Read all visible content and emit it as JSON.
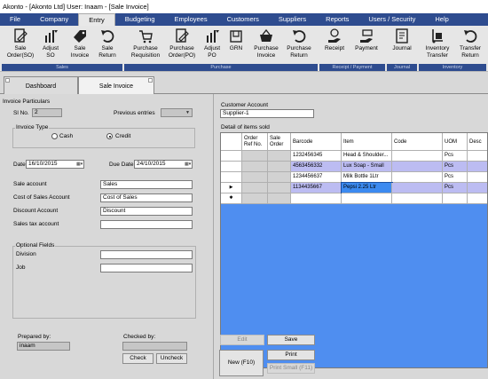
{
  "titlebar": {
    "text": "Akonto - [Akonto Ltd]  User: Inaam - [Sale Invoice]"
  },
  "menu": [
    "File",
    "Company",
    "Entry",
    "Budgeting",
    "Employees",
    "Customers",
    "Suppliers",
    "Reports",
    "Users / Security",
    "Help"
  ],
  "ribbon": {
    "buttons": [
      {
        "l1": "Sale",
        "l2": "Order(SO)"
      },
      {
        "l1": "Adjust",
        "l2": "SO"
      },
      {
        "l1": "Sale",
        "l2": "Invoice"
      },
      {
        "l1": "Sale",
        "l2": "Return"
      },
      {
        "l1": "Purchase",
        "l2": "Requisition"
      },
      {
        "l1": "Purchase",
        "l2": "Order(PO)"
      },
      {
        "l1": "Adjust",
        "l2": "PO"
      },
      {
        "l1": "GRN",
        "l2": ""
      },
      {
        "l1": "Purchase",
        "l2": "Invoice"
      },
      {
        "l1": "Purchase",
        "l2": "Return"
      },
      {
        "l1": "Receipt",
        "l2": ""
      },
      {
        "l1": "Payment",
        "l2": ""
      },
      {
        "l1": "Journal",
        "l2": ""
      },
      {
        "l1": "Inventory",
        "l2": "Transfer"
      },
      {
        "l1": "Transfer",
        "l2": "Return"
      }
    ],
    "groups": [
      "Sales",
      "Purchase",
      "Receipt / Payment",
      "Journal",
      "Inventory"
    ]
  },
  "tabs": {
    "dashboard": "Dashboard",
    "sale_invoice": "Sale Invoice"
  },
  "left": {
    "section_title": "Invoice Particulars",
    "sl_no_label": "Sl No.",
    "sl_no_value": "2",
    "prev_entries_label": "Previous entries",
    "invoice_type_label": "Invoice Type",
    "cash_label": "Cash",
    "credit_label": "Credit",
    "date_label": "Date",
    "date_value": "16/10/2015",
    "due_date_label": "Due Date",
    "due_date_value": "24/10/2015",
    "sale_account_label": "Sale account",
    "sale_account_value": "Sales",
    "cost_of_sales_label": "Cost of Sales Account",
    "cost_of_sales_value": "Cost of Sales",
    "discount_account_label": "Discount Account",
    "discount_account_value": "Discount",
    "sales_tax_label": "Sales tax account",
    "optional_fields_label": "Optional Fields",
    "division_label": "Division",
    "job_label": "Job",
    "prepared_by_label": "Prepared by:",
    "prepared_by_value": "inaam",
    "checked_by_label": "Checked by:",
    "check_btn": "Check",
    "uncheck_btn": "Uncheck"
  },
  "right": {
    "customer_account_label": "Customer Account",
    "customer_account_value": "Supplier-1",
    "detail_label": "Detail of items sold",
    "columns": [
      "Order Ref No.",
      "Sale Order",
      "Barcode",
      "Item",
      "Code",
      "UOM",
      "Desc"
    ],
    "rows": [
      {
        "barcode": "1232456345",
        "item": "Head & Shoulder...",
        "code": "",
        "uom": "Pcs"
      },
      {
        "barcode": "4563456332",
        "item": "Lux Soap - Small",
        "code": "",
        "uom": "Pcs"
      },
      {
        "barcode": "1234456637",
        "item": "Milk Bottle 1Ltr",
        "code": "",
        "uom": "Pcs"
      },
      {
        "barcode": "1134435667",
        "item": "Pepsi 2.25 Ltr",
        "code": "",
        "uom": "Pcs"
      }
    ],
    "edit_btn": "Edit",
    "new_btn": "New (F10)",
    "save_btn": "Save",
    "print_btn": "Print",
    "print_small_btn": "Print Small (F11)"
  }
}
